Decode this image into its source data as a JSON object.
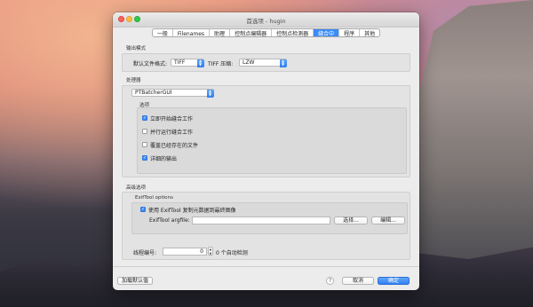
{
  "window": {
    "title": "首选项 - hugin"
  },
  "tabs": [
    {
      "label": "一般"
    },
    {
      "label": "Filenames"
    },
    {
      "label": "助理"
    },
    {
      "label": "控制点编辑器"
    },
    {
      "label": "控制点检测器"
    },
    {
      "label": "缝合中",
      "active": true
    },
    {
      "label": "程序"
    },
    {
      "label": "其他"
    }
  ],
  "output_mode": {
    "section_title": "输出模式",
    "default_format_label": "默认文件格式:",
    "default_format_value": "TIFF",
    "tiff_compression_label": "TIFF 压缩:",
    "tiff_compression_value": "LZW"
  },
  "processor": {
    "section_title": "处理器",
    "selected": "PTBatcherGUI",
    "options_title": "选项",
    "options": [
      {
        "label": "立即开始缝合工作",
        "checked": true
      },
      {
        "label": "并行运行缝合工作",
        "checked": false
      },
      {
        "label": "覆盖已经存在的文件",
        "checked": false
      },
      {
        "label": "详细的输出",
        "checked": true
      }
    ]
  },
  "advanced": {
    "section_title": "高级选项",
    "exiftool_title": "ExifTool options",
    "use_exiftool_label": "使用 ExifTool 复制元数据到最终图像",
    "use_exiftool_checked": true,
    "argfile_label": "ExifTool argfile:",
    "argfile_value": "",
    "choose_button": "选择...",
    "edit_button": "编辑...",
    "threads_label": "线程编号:",
    "threads_value": "0",
    "threads_hint": "0 个自动检测"
  },
  "footer": {
    "load_defaults": "加载默认值",
    "help": "?",
    "cancel": "取消",
    "ok": "确定"
  },
  "colors": {
    "accent": "#3b8cf6",
    "close": "#fc615d",
    "minimize": "#fdbc40",
    "maximize": "#34c84a"
  }
}
